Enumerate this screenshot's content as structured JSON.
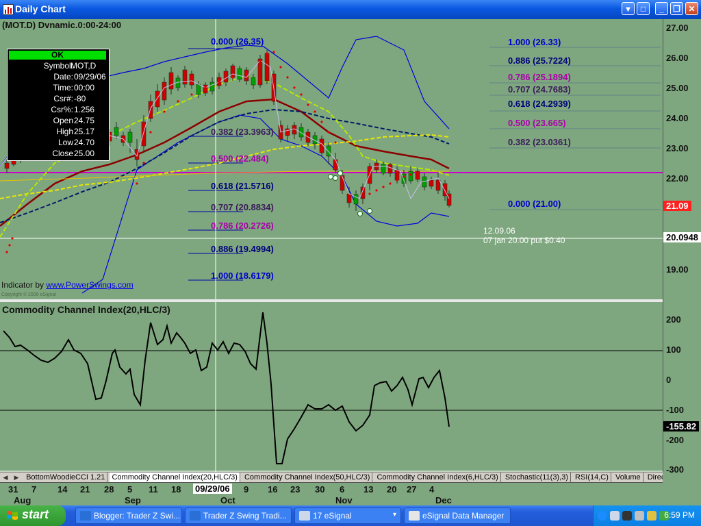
{
  "window": {
    "title": "Daily Chart"
  },
  "chart": {
    "symbol_line": "(MOT.D) Dvnamic.0:00-24:00",
    "info": {
      "status": "OK",
      "rows": [
        {
          "label": "Symbol:",
          "value": "MOT,D"
        },
        {
          "label": "Date:",
          "value": "09/29/06"
        },
        {
          "label": "Time:",
          "value": "00:00"
        },
        {
          "label": "Csr#:",
          "value": "-80"
        },
        {
          "label": "Csr%:",
          "value": "1.256"
        },
        {
          "label": "Open",
          "value": "24.75"
        },
        {
          "label": "High",
          "value": "25.17"
        },
        {
          "label": "Low",
          "value": "24.70"
        },
        {
          "label": "Close",
          "value": "25.00"
        }
      ]
    },
    "fib_left": [
      {
        "text": "0.000 (26.35)",
        "color": "#0000cc"
      },
      {
        "text": "0.382 (23.3963)",
        "color": "#3a1a5a"
      },
      {
        "text": "0.500 (22.484)",
        "color": "#aa00aa"
      },
      {
        "text": "0.618 (21.5716)",
        "color": "#00007a"
      },
      {
        "text": "0.707 (20.8834)",
        "color": "#3a1a5a"
      },
      {
        "text": "0.786 (20.2726)",
        "color": "#aa00aa"
      },
      {
        "text": "0.886 (19.4994)",
        "color": "#00007a"
      },
      {
        "text": "1.000 (18.6179)",
        "color": "#0000cc"
      }
    ],
    "fib_right": [
      {
        "text": "1.000 (26.33)",
        "color": "#0000cc"
      },
      {
        "text": "0.886 (25.7224)",
        "color": "#00007a"
      },
      {
        "text": "0.786 (25.1894)",
        "color": "#aa00aa"
      },
      {
        "text": "0.707 (24.7683)",
        "color": "#3a1a5a"
      },
      {
        "text": "0.618 (24.2939)",
        "color": "#00007a"
      },
      {
        "text": "0.500 (23.665)",
        "color": "#aa00aa"
      },
      {
        "text": "0.382 (23.0361)",
        "color": "#3a1a5a"
      },
      {
        "text": "0.000 (21.00)",
        "color": "#0000cc"
      }
    ],
    "annotation_date": "12.09.06",
    "annotation_note": "07 jan 20.00 put $0.40",
    "indicator_by": "Indicator by",
    "indicator_link": "www.PowerSwings.com",
    "copyright": "Copyright © 2006 eSignal",
    "price_scale": [
      "27.00",
      "26.00",
      "25.00",
      "24.00",
      "23.00",
      "22.00",
      "19.00"
    ],
    "last_price": "21.09",
    "line_price": "20.0948",
    "last_price_color": "#ff2020"
  },
  "cci": {
    "title": "Commodity Channel Index(20,HLC/3)",
    "scale": [
      "200",
      "100",
      "0",
      "-100",
      "-200",
      "-300"
    ],
    "last_value": "-155.82"
  },
  "tabs": [
    "BottomWoodieCCI 1.21",
    "Commodity Channel Index(20,HLC/3)",
    "Commodity Channel Index(50,HLC/3)",
    "Commodity Channel Index(6,HLC/3)",
    "Stochastic(11(3),3)",
    "RSI(14,C)",
    "Volume",
    "Directiona"
  ],
  "active_tab": "Commodity Channel Index(20,HLC/3)",
  "xaxis": {
    "days": [
      "31",
      "7",
      "14",
      "21",
      "28",
      "5",
      "11",
      "18",
      "9",
      "16",
      "23",
      "30",
      "6",
      "13",
      "20",
      "27",
      "4"
    ],
    "selected_date": "09/29/06",
    "months": [
      "Aug",
      "Sep",
      "Oct",
      "Nov",
      "Dec"
    ]
  },
  "taskbar": {
    "start_label": "start",
    "items": [
      {
        "label": "Blogger: Trader Z Swi...",
        "active": false
      },
      {
        "label": "Trader Z Swing Tradi...",
        "active": false
      },
      {
        "label": "17 eSignal",
        "active": false
      },
      {
        "label": "eSignal Data Manager",
        "active": false
      }
    ],
    "clock": "6:59 PM"
  },
  "colors": {
    "background": "#7fa77f",
    "ok_green": "#00e000",
    "ma_dark_red": "#8b0000",
    "ma_dark_blue": "#001a66",
    "ma_yellow": "#e8e800",
    "ma_light_green": "#b8e800",
    "bollinger": "#0000dd",
    "horizontal_line": "#cc00cc",
    "candle_up": "#00a000",
    "candle_down": "#d00000",
    "sar_dots": "#e00000"
  }
}
